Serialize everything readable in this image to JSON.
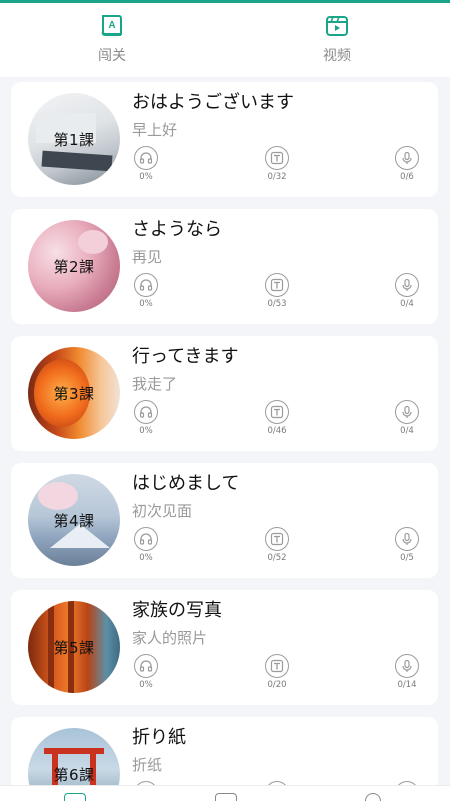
{
  "colors": {
    "accent": "#1aa58a",
    "stat_icon": "#9b9b9b"
  },
  "tabs": [
    {
      "label": "闯关",
      "icon": "book-icon"
    },
    {
      "label": "视频",
      "icon": "video-icon"
    }
  ],
  "lessons": [
    {
      "num": "第1課",
      "title": "おはようございます",
      "subtitle": "早上好",
      "listen": "0%",
      "text": "0/32",
      "speak": "0/6"
    },
    {
      "num": "第2課",
      "title": "さようなら",
      "subtitle": "再见",
      "listen": "0%",
      "text": "0/53",
      "speak": "0/4"
    },
    {
      "num": "第3課",
      "title": "行ってきます",
      "subtitle": "我走了",
      "listen": "0%",
      "text": "0/46",
      "speak": "0/4"
    },
    {
      "num": "第4課",
      "title": "はじめまして",
      "subtitle": "初次见面",
      "listen": "0%",
      "text": "0/52",
      "speak": "0/5"
    },
    {
      "num": "第5課",
      "title": "家族の写真",
      "subtitle": "家人的照片",
      "listen": "0%",
      "text": "0/20",
      "speak": "0/14"
    },
    {
      "num": "第6課",
      "title": "折り紙",
      "subtitle": "折纸",
      "listen": "",
      "text": "",
      "speak": ""
    }
  ]
}
